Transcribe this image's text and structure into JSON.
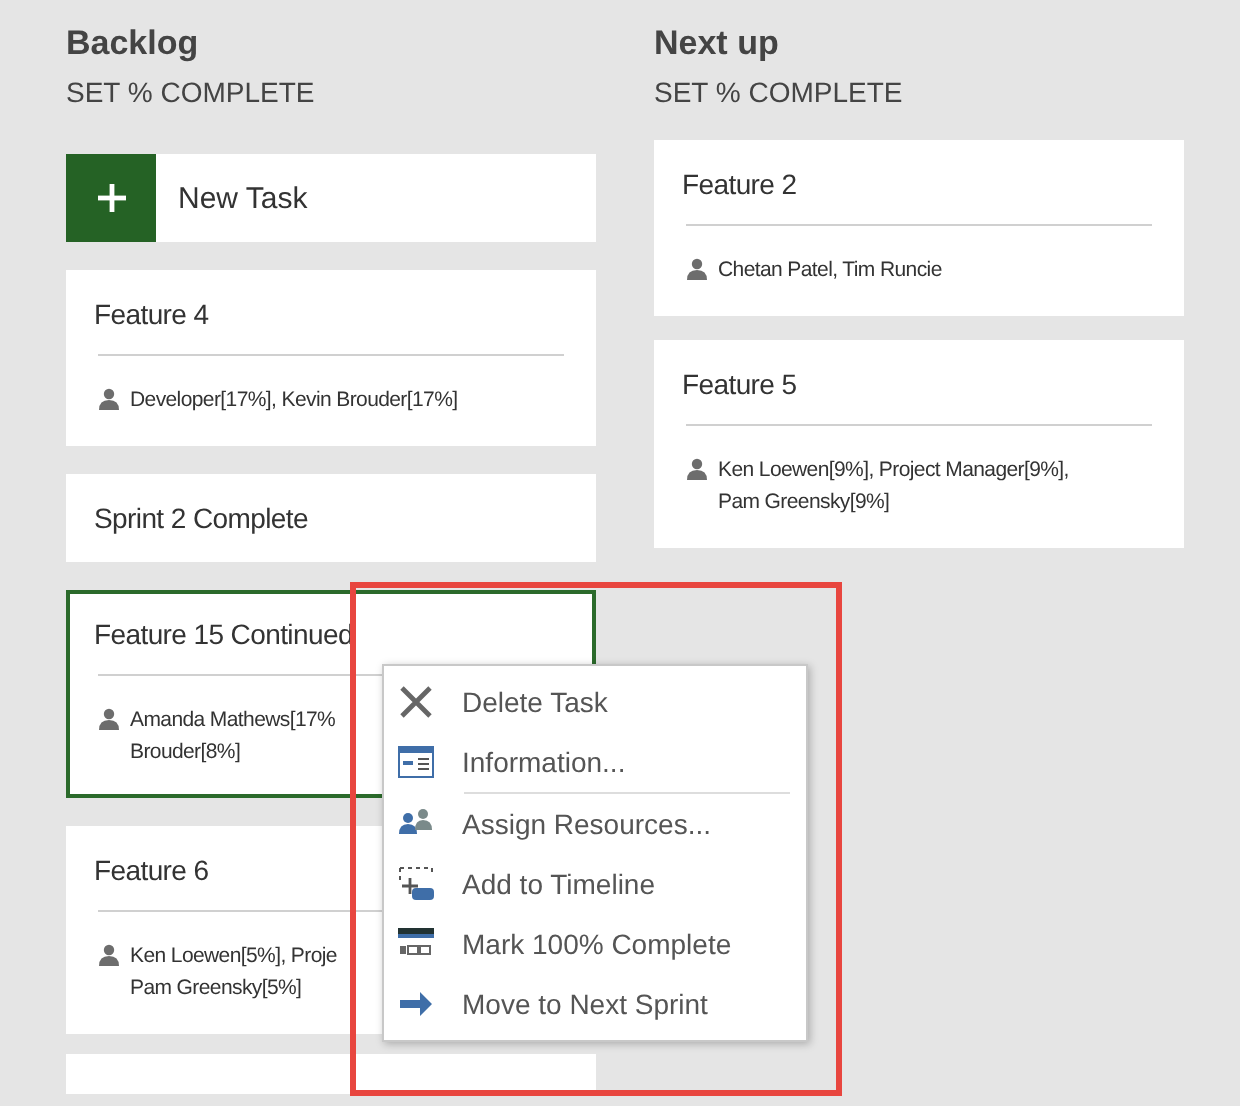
{
  "columns": [
    {
      "title": "Backlog",
      "subtitle": "SET % COMPLETE",
      "new_task": {
        "label": "New Task"
      },
      "cards": [
        {
          "title": "Feature 4",
          "selected": false,
          "resources": [
            "Developer[17%], Kevin Brouder[17%]"
          ]
        },
        {
          "title": "Sprint 2 Complete",
          "selected": false
        },
        {
          "title": "Feature 15 Continued",
          "selected": true,
          "resources": [
            "Amanda Mathews[17%",
            "Brouder[8%]"
          ]
        },
        {
          "title": "Feature 6",
          "selected": false,
          "resources": [
            "Ken Loewen[5%], Proje",
            "Pam Greensky[5%]"
          ]
        },
        {
          "selected": false
        }
      ]
    },
    {
      "title": "Next up",
      "subtitle": "SET % COMPLETE",
      "cards": [
        {
          "title": "Feature 2",
          "selected": false,
          "resources": [
            "Chetan Patel, Tim Runcie"
          ]
        },
        {
          "title": "Feature 5",
          "selected": false,
          "resources": [
            "Ken Loewen[9%], Project Manager[9%],",
            "Pam Greensky[9%]"
          ]
        }
      ]
    }
  ],
  "context_menu": {
    "items": [
      {
        "kind": "delete",
        "label": "Delete Task"
      },
      {
        "kind": "info",
        "label": "Information..."
      },
      {
        "kind": "separator"
      },
      {
        "kind": "assign",
        "label": "Assign Resources..."
      },
      {
        "kind": "timeline",
        "label": "Add to Timeline"
      },
      {
        "kind": "complete",
        "label": "Mark 100% Complete"
      },
      {
        "kind": "move",
        "label": "Move to Next Sprint"
      }
    ]
  }
}
